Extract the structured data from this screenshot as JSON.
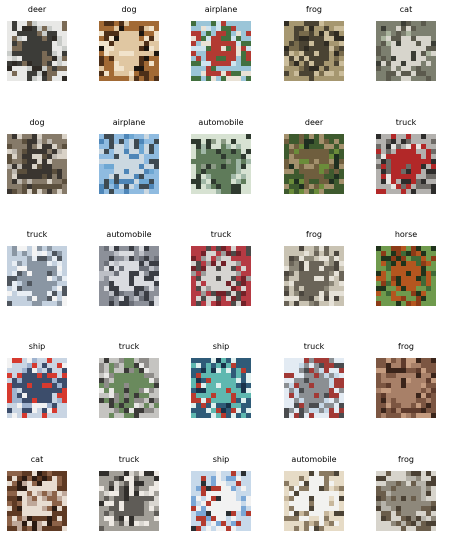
{
  "images": [
    {
      "label": "deer",
      "palette": [
        "#c9ccc9",
        "#e8e8e6",
        "#3c3c38",
        "#7a6a55",
        "#2e2a25"
      ]
    },
    {
      "label": "dog",
      "palette": [
        "#1b150f",
        "#a26a35",
        "#e0c7a2",
        "#4d2f18",
        "#f1e3cb"
      ]
    },
    {
      "label": "airplane",
      "palette": [
        "#cfe4ef",
        "#9bc5d8",
        "#b23a32",
        "#42703f",
        "#e9e2d6"
      ]
    },
    {
      "label": "frog",
      "palette": [
        "#786b4c",
        "#a69770",
        "#4a4333",
        "#cbbd9b",
        "#2f2b22"
      ]
    },
    {
      "label": "cat",
      "palette": [
        "#a9b39d",
        "#7c7f6f",
        "#d7d5cc",
        "#5b5a4d",
        "#3b3d35"
      ]
    },
    {
      "label": "dog",
      "palette": [
        "#bcb6ad",
        "#867a69",
        "#3a3530",
        "#5b4f3d",
        "#d9d2c7"
      ]
    },
    {
      "label": "airplane",
      "palette": [
        "#6ea7d3",
        "#8fbbe0",
        "#cbd8e1",
        "#3e4a52",
        "#4e86b8"
      ]
    },
    {
      "label": "automobile",
      "palette": [
        "#a0b7a6",
        "#d7e2d2",
        "#5f7b5a",
        "#2f3a2f",
        "#8a9a84"
      ]
    },
    {
      "label": "deer",
      "palette": [
        "#1f2f20",
        "#3e5a2e",
        "#6f5e3e",
        "#a3906c",
        "#6b8c3a"
      ]
    },
    {
      "label": "truck",
      "palette": [
        "#e7e6e3",
        "#b3b1ae",
        "#b22828",
        "#6d6a66",
        "#2d2c2b"
      ]
    },
    {
      "label": "truck",
      "palette": [
        "#e8eef4",
        "#c4d1df",
        "#8a96a3",
        "#f4f4f4",
        "#4f565e"
      ]
    },
    {
      "label": "automobile",
      "palette": [
        "#bcbfc6",
        "#8c9099",
        "#d9dbe0",
        "#3a3d44",
        "#6b6f78"
      ]
    },
    {
      "label": "truck",
      "palette": [
        "#9c9c9a",
        "#b53a43",
        "#d6d4d1",
        "#4c4a48",
        "#722128"
      ]
    },
    {
      "label": "frog",
      "palette": [
        "#8b8677",
        "#c9c3b3",
        "#6a6458",
        "#e6e2d8",
        "#4b463e"
      ]
    },
    {
      "label": "horse",
      "palette": [
        "#3f6a37",
        "#6f9a4d",
        "#b4561f",
        "#1f331b",
        "#8c3b17"
      ]
    },
    {
      "label": "ship",
      "palette": [
        "#9fb3cf",
        "#c9d5e3",
        "#3c4d6b",
        "#d63a2f",
        "#f2f2f2"
      ]
    },
    {
      "label": "truck",
      "palette": [
        "#e9e8e6",
        "#c5c4c1",
        "#6a8a5d",
        "#8e8c89",
        "#3b3a38"
      ]
    },
    {
      "label": "ship",
      "palette": [
        "#18324a",
        "#2f5b78",
        "#5fb8b0",
        "#e0f0ef",
        "#b93a2e"
      ]
    },
    {
      "label": "truck",
      "palette": [
        "#c7d8e7",
        "#e3ebf3",
        "#8b8f93",
        "#a23a36",
        "#4a4c4f"
      ]
    },
    {
      "label": "frog",
      "palette": [
        "#5e3b2c",
        "#7c5642",
        "#a88068",
        "#3a241a",
        "#c49b7f"
      ]
    },
    {
      "label": "cat",
      "palette": [
        "#2a1a12",
        "#5e3a24",
        "#e8ddd2",
        "#8c6248",
        "#bfa89a"
      ]
    },
    {
      "label": "truck",
      "palette": [
        "#d9d6d0",
        "#a29f98",
        "#5f5c57",
        "#eeeae4",
        "#302e2b"
      ]
    },
    {
      "label": "ship",
      "palette": [
        "#7aa7d6",
        "#c7d9ea",
        "#f2f2f2",
        "#b33a2e",
        "#2a2f33"
      ]
    },
    {
      "label": "automobile",
      "palette": [
        "#c7b79c",
        "#e6dbc6",
        "#f2f2f0",
        "#8a7a62",
        "#4b4336"
      ]
    },
    {
      "label": "frog",
      "palette": [
        "#b6b3aa",
        "#d7d4cc",
        "#8e887b",
        "#6a5d4b",
        "#4a4033"
      ]
    }
  ]
}
